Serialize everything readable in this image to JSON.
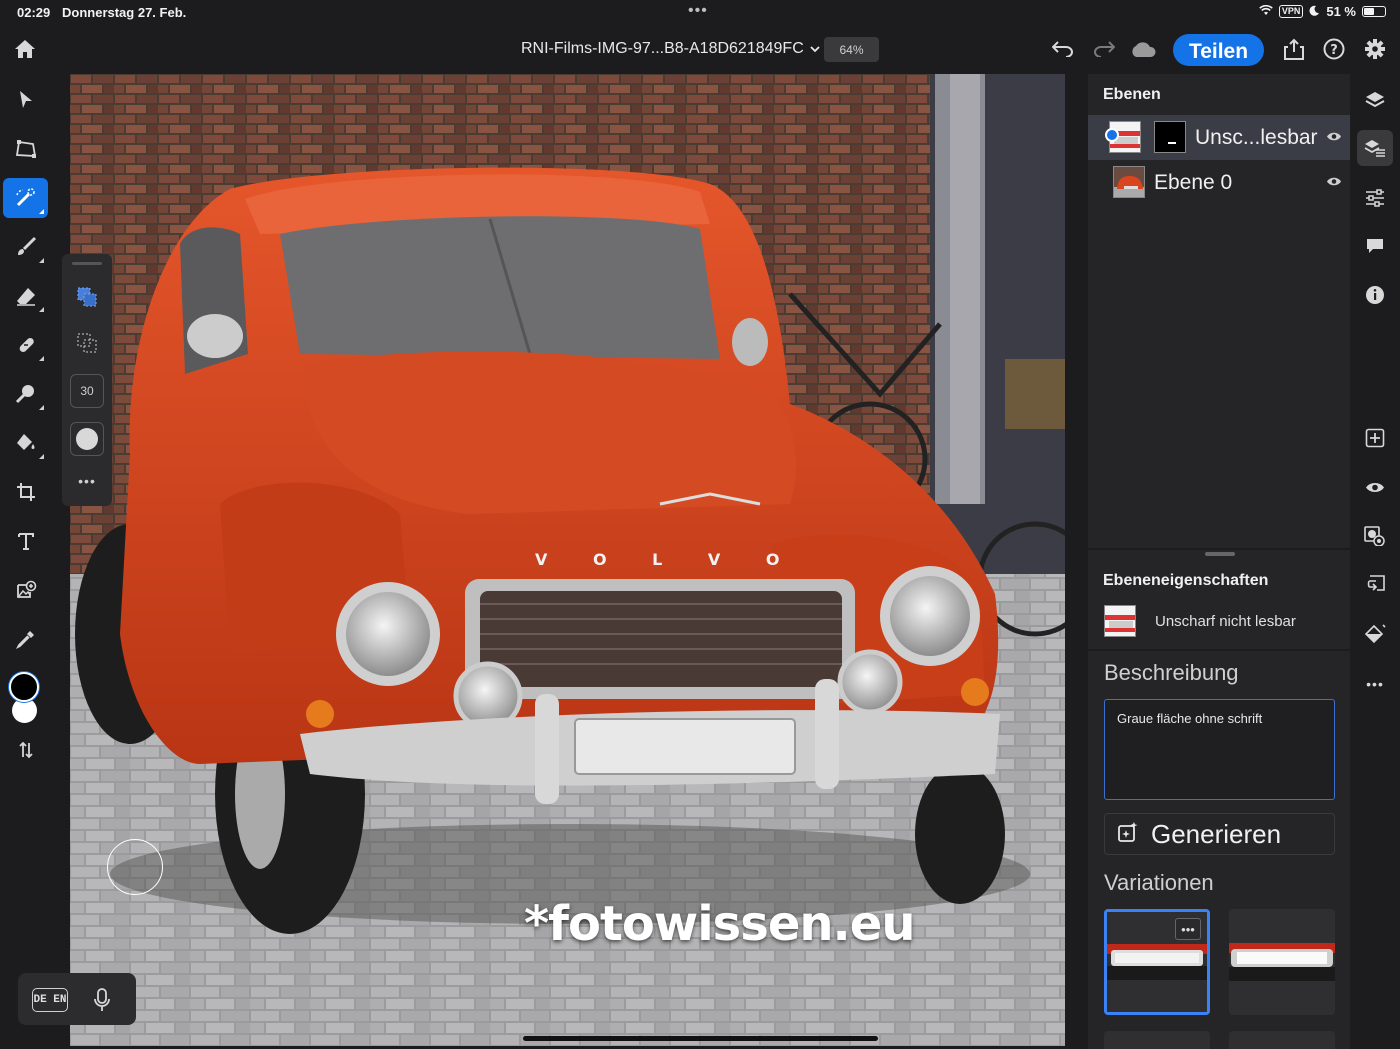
{
  "status": {
    "time": "02:29",
    "date": "Donnerstag 27. Feb.",
    "more_dots": "•••",
    "vpn": "VPN",
    "battery": "51 %"
  },
  "topbar": {
    "filename": "RNI-Films-IMG-97...B8-A18D621849FC",
    "zoom": "64%",
    "share_label": "Teilen"
  },
  "palette": {
    "brush_size": "30",
    "more": "•••"
  },
  "canvas": {
    "grille_badge": "V O L V O",
    "watermark": "*fotowissen.eu"
  },
  "keyboard_pill": {
    "lang": "DE EN"
  },
  "layers_panel": {
    "title": "Ebenen",
    "layers": [
      {
        "name": "Unsc...lesbar"
      },
      {
        "name": "Ebene 0"
      }
    ]
  },
  "layer_properties": {
    "title": "Ebeneneigenschaften",
    "layer_name": "Unscharf nicht lesbar"
  },
  "generative": {
    "description_heading": "Beschreibung",
    "description_text": "Graue fläche ohne schrift",
    "generate_label": "Generieren",
    "variations_heading": "Variationen"
  },
  "colors": {
    "accent": "#1473e6",
    "car_body": "#d8451e",
    "foreground_swatch": "#000000",
    "background_swatch": "#ffffff"
  }
}
